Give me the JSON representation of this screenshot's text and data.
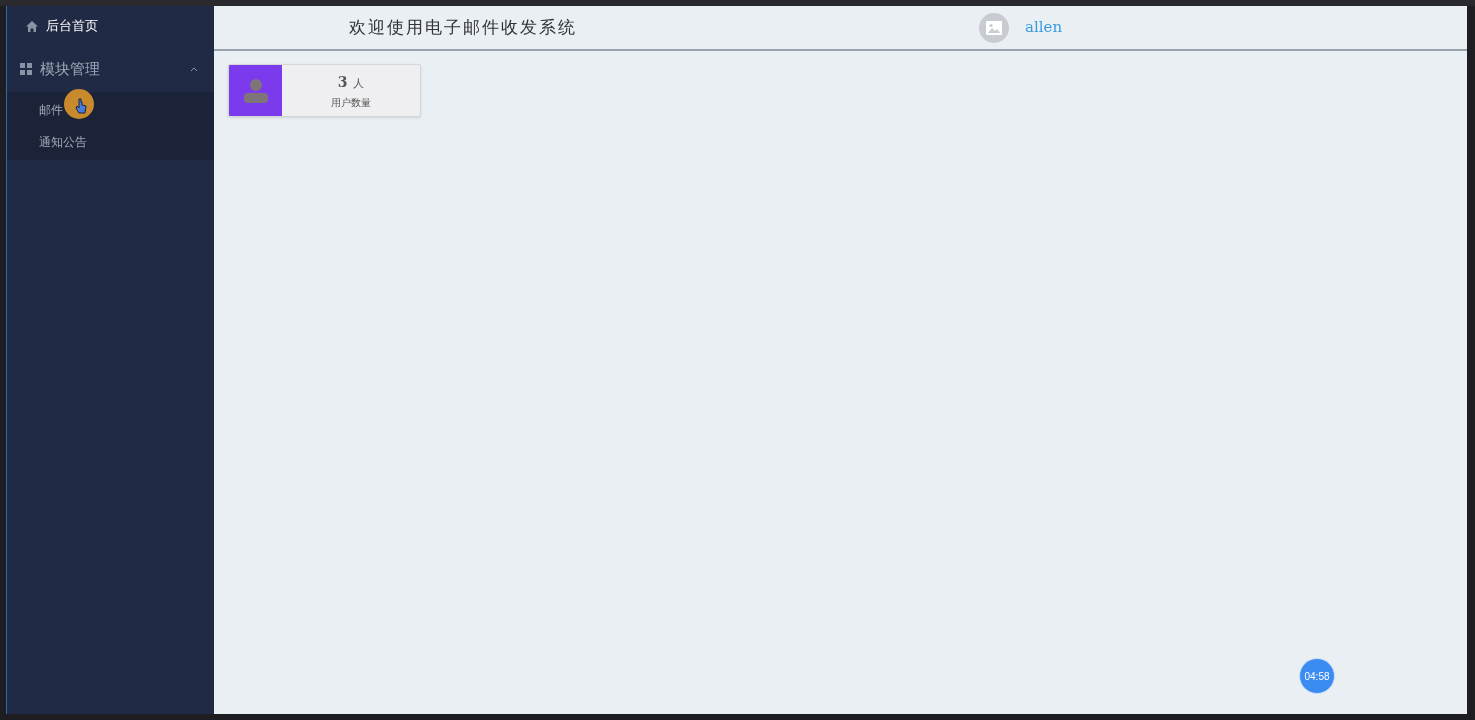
{
  "sidebar": {
    "items": [
      {
        "kind": "link",
        "label": "后台首页",
        "selected": true
      },
      {
        "kind": "group",
        "label": "模块管理",
        "expanded": true,
        "children": [
          {
            "label": "邮件"
          },
          {
            "label": "通知公告"
          }
        ]
      }
    ]
  },
  "header": {
    "title": "欢迎使用电子邮件收发系统",
    "user": "allen"
  },
  "stats": [
    {
      "value": "3",
      "unit": "人",
      "label": "用户数量",
      "color": "#7c3aed"
    }
  ],
  "timer": "04:58"
}
